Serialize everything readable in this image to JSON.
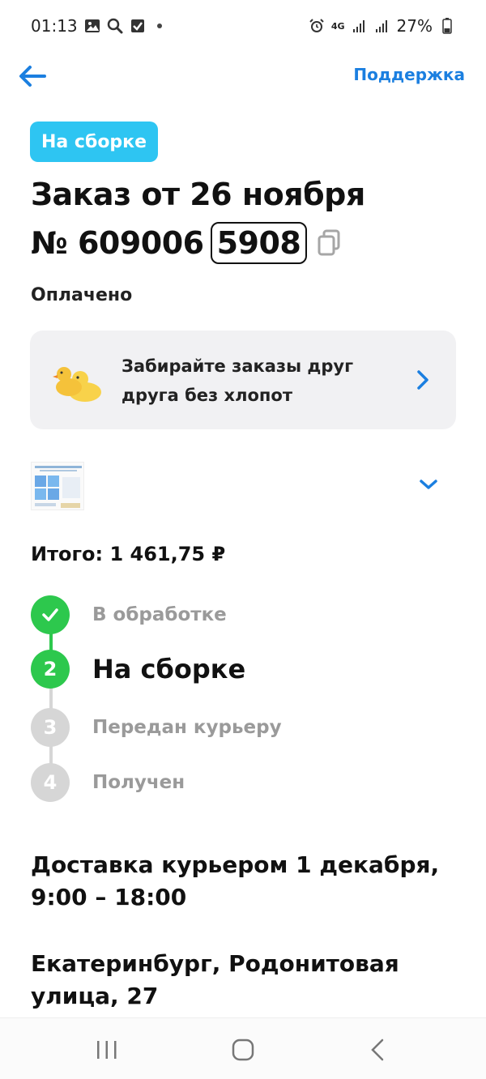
{
  "status_bar": {
    "time": "01:13",
    "network": "4G",
    "battery": "27%",
    "icons_left": [
      "image-icon",
      "search-icon",
      "checkbox-icon",
      "dot-icon"
    ],
    "icons_right": [
      "alarm-icon",
      "network-4g-icon",
      "signal-icon",
      "signal-icon",
      "battery-icon"
    ]
  },
  "header": {
    "back_icon": "arrow-left-icon",
    "support_label": "Поддержка",
    "accent_color": "#1b7fe0"
  },
  "order": {
    "status_chip": "На сборке",
    "status_chip_color": "#2ec5f2",
    "title": "Заказ от 26 ноября",
    "number_prefix": "№ 609006",
    "number_tail": "5908",
    "payment_status": "Оплачено"
  },
  "promo": {
    "text": "Забирайте заказы друг друга без хлопот",
    "icon": "ducks-icon"
  },
  "product": {
    "thumbnail": "product-thumbnail"
  },
  "total": {
    "label": "Итого: 1 461,75 ₽"
  },
  "steps": [
    {
      "marker": "",
      "label": "В обработке",
      "state": "done"
    },
    {
      "marker": "2",
      "label": "На сборке",
      "state": "active"
    },
    {
      "marker": "3",
      "label": "Передан курьеру",
      "state": "pending"
    },
    {
      "marker": "4",
      "label": "Получен",
      "state": "pending"
    }
  ],
  "step_colors": {
    "done": "#2dc84d",
    "pending": "#d6d6d6"
  },
  "delivery": {
    "text": "Доставка курьером 1 декабря, 9:00 – 18:00"
  },
  "address": {
    "text": "Екатеринбург, Родонитовая улица, 27"
  },
  "nav_bar": {
    "buttons": [
      "recent-apps-icon",
      "home-icon",
      "back-icon"
    ]
  }
}
